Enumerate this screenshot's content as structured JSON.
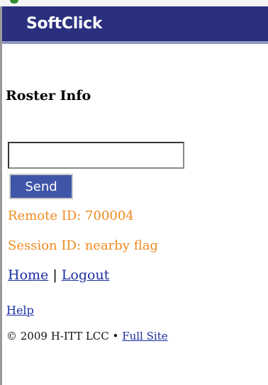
{
  "app": {
    "title": "SoftClick"
  },
  "page": {
    "title": "Roster Info"
  },
  "form": {
    "input_value": "",
    "send_label": "Send"
  },
  "info": {
    "remote_id": "Remote ID: 700004",
    "session_id": "Session ID: nearby flag"
  },
  "nav": {
    "home_label": "Home",
    "separator": "|",
    "logout_label": "Logout",
    "help_label": "Help"
  },
  "footer": {
    "copyright": "© 2009 H-ITT LCC",
    "bullet": "•",
    "full_site_label": "Full Site"
  },
  "colors": {
    "header_background": "#2a2f7e",
    "info_text": "#f08a20",
    "link": "#1b2fa0",
    "button_background": "#3f55a8"
  }
}
